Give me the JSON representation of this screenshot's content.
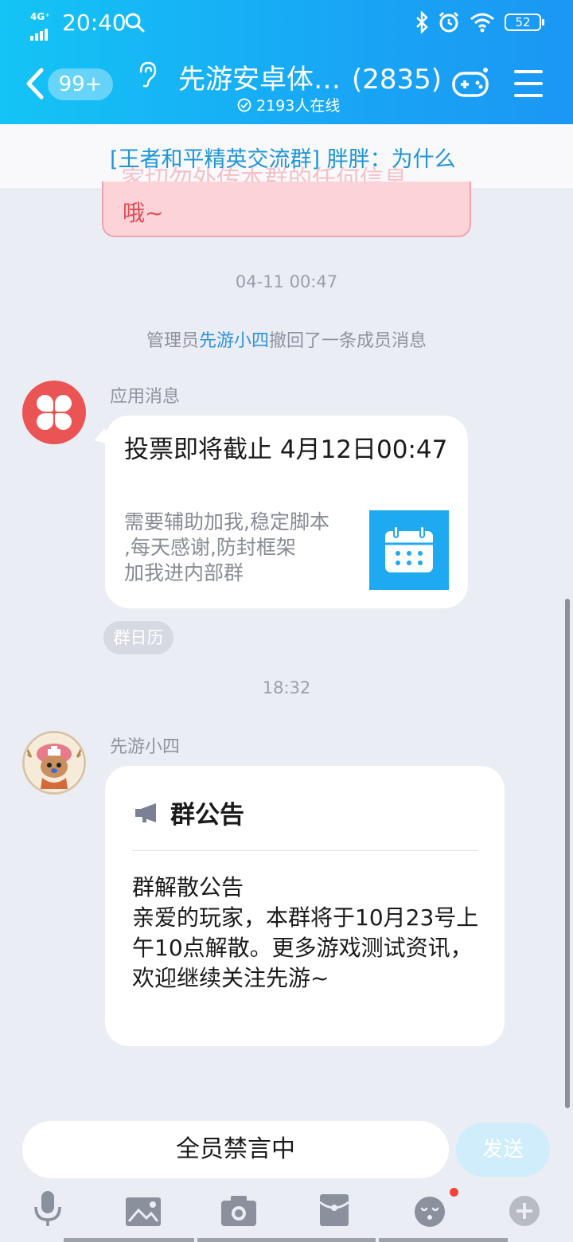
{
  "status_bar": {
    "network": "4G⁺",
    "time": "20:40",
    "battery": "52"
  },
  "header": {
    "unread_badge": "99+",
    "group_name": "先游安卓体…",
    "member_count": "(2835)",
    "online_text": "2193人在线"
  },
  "pinned": {
    "text": "[王者和平精英交流群] 胖胖：为什么",
    "ghost_text": "家切勿外传本群的任何信息"
  },
  "prev_message_tail": "哦~",
  "timestamps": [
    "04-11 00:47",
    "18:32"
  ],
  "system_notice": {
    "prefix": "管理员",
    "name": "先游小四",
    "suffix": "撤回了一条成员消息"
  },
  "app_message": {
    "sender": "应用消息",
    "title": "投票即将截止 4月12日00:47",
    "desc_lines": [
      "需要辅助加我,稳定脚本",
      ",每天感谢,防封框架",
      "加我进内部群"
    ],
    "chip": "群日历"
  },
  "notice_message": {
    "sender": "先游小四",
    "header": "群公告",
    "body": "群解散公告\n亲爱的玩家，本群将于10月23号上午10点解散。更多游戏测试资讯，欢迎继续关注先游~"
  },
  "input": {
    "placeholder": "全员禁言中",
    "send_label": "发送"
  },
  "toolbar_icons": [
    "mic-icon",
    "image-icon",
    "camera-icon",
    "red-packet-icon",
    "emoji-icon",
    "plus-icon"
  ],
  "colors": {
    "header_start": "#14c4f5",
    "header_end": "#1b97f4",
    "link_blue": "#1f95d9",
    "app_avatar_red": "#ea5454",
    "calendar_blue": "#1ea9f0"
  }
}
